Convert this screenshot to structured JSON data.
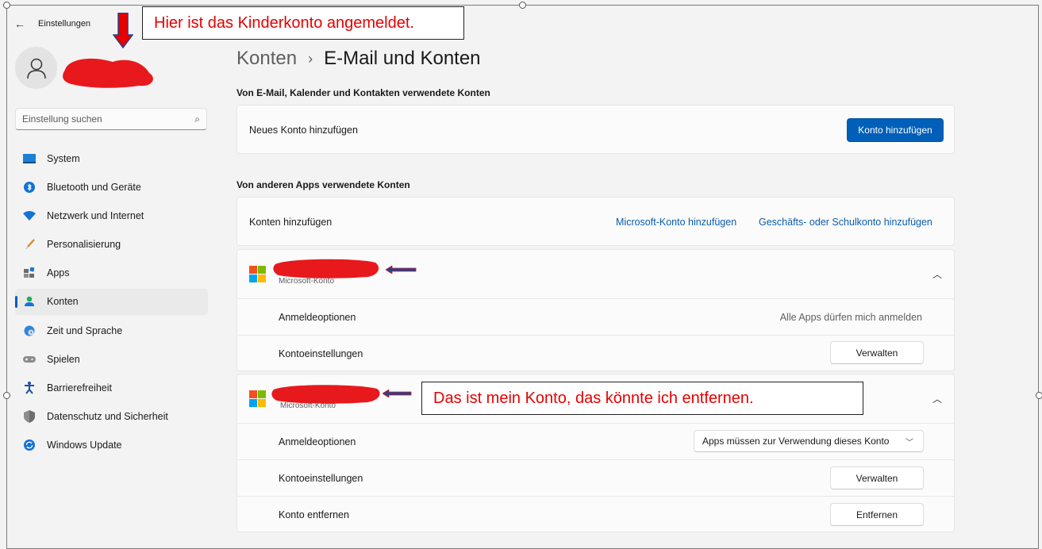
{
  "window": {
    "title": "Einstellungen"
  },
  "sidebar": {
    "search_placeholder": "Einstellung suchen",
    "items": [
      {
        "label": "System",
        "icon": "monitor-icon"
      },
      {
        "label": "Bluetooth und Geräte",
        "icon": "bluetooth-icon"
      },
      {
        "label": "Netzwerk und Internet",
        "icon": "wifi-icon"
      },
      {
        "label": "Personalisierung",
        "icon": "brush-icon"
      },
      {
        "label": "Apps",
        "icon": "apps-icon"
      },
      {
        "label": "Konten",
        "icon": "person-icon",
        "active": true
      },
      {
        "label": "Zeit und Sprache",
        "icon": "globe-clock-icon"
      },
      {
        "label": "Spielen",
        "icon": "gamepad-icon"
      },
      {
        "label": "Barrierefreiheit",
        "icon": "accessibility-icon"
      },
      {
        "label": "Datenschutz und Sicherheit",
        "icon": "shield-icon"
      },
      {
        "label": "Windows Update",
        "icon": "update-icon"
      }
    ]
  },
  "header": {
    "parent": "Konten",
    "separator": "›",
    "current": "E-Mail und Konten"
  },
  "email_section": {
    "title": "Von E-Mail, Kalender und Kontakten verwendete Konten",
    "add_row_label": "Neues Konto hinzufügen",
    "add_button": "Konto hinzufügen"
  },
  "other_apps_section": {
    "title": "Von anderen Apps verwendete Konten",
    "row_label": "Konten hinzufügen",
    "link_microsoft": "Microsoft-Konto hinzufügen",
    "link_work": "Geschäfts- oder Schulkonto hinzufügen"
  },
  "account1": {
    "type": "Microsoft-Konto",
    "signin_label": "Anmeldeoptionen",
    "signin_value": "Alle Apps dürfen mich anmelden",
    "settings_label": "Kontoeinstellungen",
    "manage_button": "Verwalten"
  },
  "account2": {
    "type": "Microsoft-Konto",
    "signin_label": "Anmeldeoptionen",
    "signin_dropdown": "Apps müssen zur Verwendung dieses Konto",
    "settings_label": "Kontoeinstellungen",
    "manage_button": "Verwalten",
    "remove_label": "Konto entfernen",
    "remove_button": "Entfernen"
  },
  "annotations": {
    "top_callout": "Hier ist das Kinderkonto angemeldet.",
    "account_callout": "Das ist mein Konto, das könnte ich entfernen."
  },
  "colors": {
    "accent": "#005fb8",
    "annotation_red": "#e60000",
    "redaction_red": "#e8191c",
    "arrow_blue": "#2b3f8c"
  }
}
